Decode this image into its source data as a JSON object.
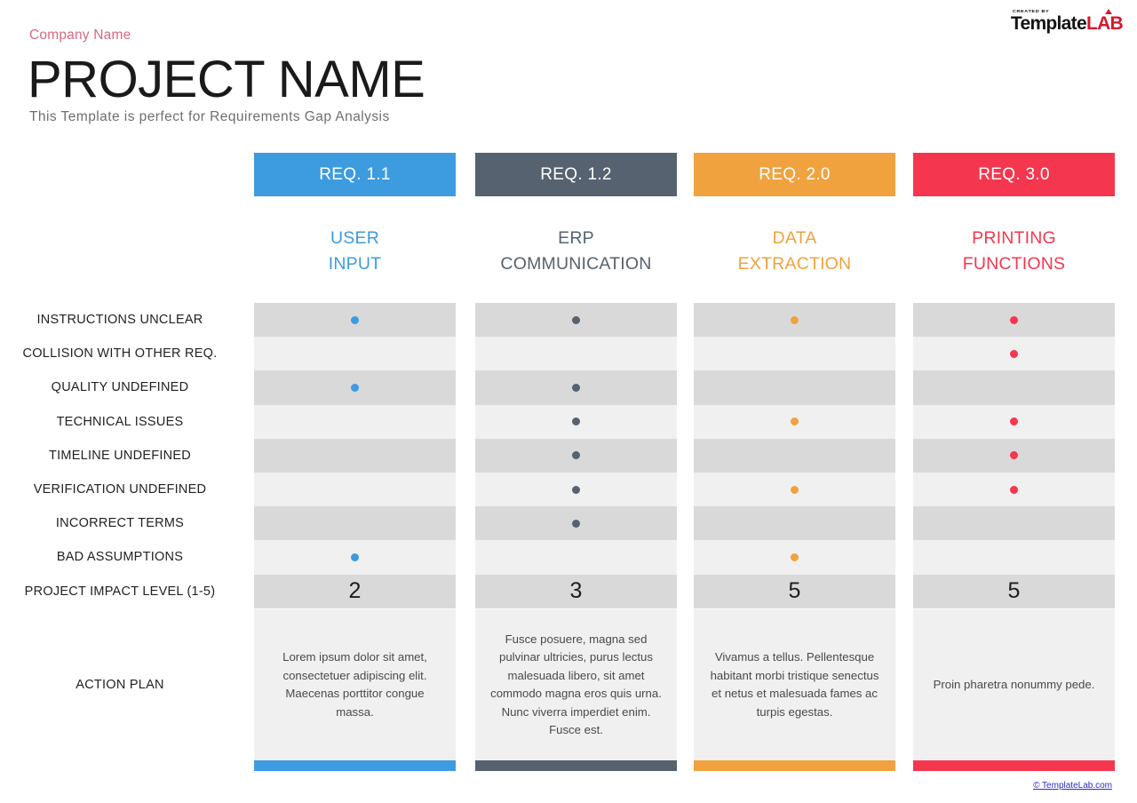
{
  "header": {
    "company_name": "Company Name",
    "project_title": "PROJECT NAME",
    "subtitle": "This Template is perfect for Requirements Gap Analysis"
  },
  "logo": {
    "created_by": "CREATED BY",
    "template": "Template",
    "lab": "LAB"
  },
  "footer": {
    "copyright": "© TemplateLab.com"
  },
  "row_labels": [
    "INSTRUCTIONS UNCLEAR",
    "COLLISION WITH OTHER REQ.",
    "QUALITY UNDEFINED",
    "TECHNICAL ISSUES",
    "TIMELINE UNDEFINED",
    "VERIFICATION UNDEFINED",
    "INCORRECT TERMS",
    "BAD ASSUMPTIONS",
    "PROJECT IMPACT LEVEL (1-5)"
  ],
  "action_plan_label": "ACTION PLAN",
  "colors": {
    "blue": "#3d9be0",
    "slate": "#56626f",
    "orange": "#f0a23f",
    "red": "#f4374f",
    "band_dark": "#d9d9d9",
    "band_light": "#f0f0f0",
    "company_pink": "#d46a80"
  },
  "chart_data": {
    "type": "table",
    "title": "Requirements Gap Analysis",
    "categories": [
      "INSTRUCTIONS UNCLEAR",
      "COLLISION WITH OTHER REQ.",
      "QUALITY UNDEFINED",
      "TECHNICAL ISSUES",
      "TIMELINE UNDEFINED",
      "VERIFICATION UNDEFINED",
      "INCORRECT TERMS",
      "BAD ASSUMPTIONS"
    ],
    "series": [
      {
        "name": "REQ. 1.1 — USER INPUT",
        "values": [
          1,
          0,
          1,
          0,
          0,
          0,
          0,
          1
        ],
        "impact": 2,
        "color": "#3d9be0"
      },
      {
        "name": "REQ. 1.2 — ERP COMMUNICATION",
        "values": [
          1,
          0,
          1,
          1,
          1,
          1,
          1,
          0
        ],
        "impact": 3,
        "color": "#56626f"
      },
      {
        "name": "REQ. 2.0 — DATA EXTRACTION",
        "values": [
          1,
          0,
          0,
          1,
          0,
          1,
          0,
          1
        ],
        "impact": 5,
        "color": "#f0a23f"
      },
      {
        "name": "REQ. 3.0 — PRINTING FUNCTIONS",
        "values": [
          1,
          1,
          0,
          1,
          1,
          1,
          0,
          0
        ],
        "impact": 5,
        "color": "#f4374f"
      }
    ],
    "impact_label": "PROJECT IMPACT LEVEL (1-5)",
    "impact_range": [
      1,
      5
    ]
  },
  "columns": [
    {
      "req": "REQ. 1.1",
      "category_line1": "USER",
      "category_line2": "INPUT",
      "color": "#3d9be0",
      "impact": "2",
      "dots": [
        true,
        false,
        true,
        false,
        false,
        false,
        false,
        true
      ],
      "action_plan": "Lorem ipsum dolor sit amet, consectetuer adipiscing elit. Maecenas porttitor congue massa."
    },
    {
      "req": "REQ. 1.2",
      "category_line1": "ERP",
      "category_line2": "COMMUNICATION",
      "color": "#56626f",
      "impact": "3",
      "dots": [
        true,
        false,
        true,
        true,
        true,
        true,
        true,
        false
      ],
      "action_plan": "Fusce posuere, magna sed pulvinar ultricies, purus lectus malesuada libero, sit amet commodo magna eros quis urna. Nunc viverra imperdiet enim. Fusce est."
    },
    {
      "req": "REQ. 2.0",
      "category_line1": "DATA",
      "category_line2": "EXTRACTION",
      "color": "#f0a23f",
      "impact": "5",
      "dots": [
        true,
        false,
        false,
        true,
        false,
        true,
        false,
        true
      ],
      "action_plan": "Vivamus a tellus. Pellentesque habitant morbi tristique senectus et netus et malesuada fames ac turpis egestas."
    },
    {
      "req": "REQ. 3.0",
      "category_line1": "PRINTING",
      "category_line2": "FUNCTIONS",
      "color": "#f4374f",
      "impact": "5",
      "dots": [
        true,
        true,
        false,
        true,
        true,
        true,
        false,
        false
      ],
      "action_plan": "Proin pharetra nonummy pede."
    }
  ]
}
